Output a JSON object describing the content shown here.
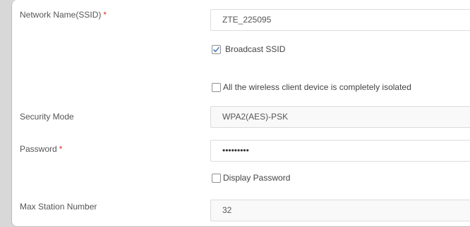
{
  "form": {
    "ssid": {
      "label": "Network Name(SSID)",
      "required_mark": "*",
      "value": "ZTE_225095"
    },
    "broadcast_ssid": {
      "label": "Broadcast SSID",
      "checked": true
    },
    "isolation": {
      "label": "All the wireless client device is completely isolated",
      "checked": false
    },
    "security_mode": {
      "label": "Security Mode",
      "value": "WPA2(AES)-PSK"
    },
    "password": {
      "label": "Password",
      "required_mark": "*",
      "value": "•••••••••"
    },
    "display_password": {
      "label": "Display Password",
      "checked": false
    },
    "max_station": {
      "label": "Max Station Number",
      "value": "32"
    }
  },
  "colors": {
    "required": "#e0301e",
    "field_border": "#dcdcdc",
    "background": "#d8d8d8"
  }
}
